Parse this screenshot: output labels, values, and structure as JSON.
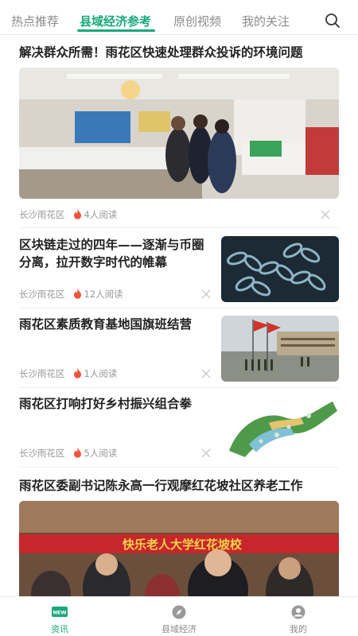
{
  "top_tabs": [
    {
      "label": "热点推荐",
      "active": false
    },
    {
      "label": "县域经济参考",
      "active": true
    },
    {
      "label": "原创视频",
      "active": false
    },
    {
      "label": "我的关注",
      "active": false
    }
  ],
  "articles": [
    {
      "title": "解决群众所需！雨花区快速处理群众投诉的环境问题",
      "source": "长沙雨花区",
      "reads": "4人阅读",
      "image": "kitchen-photo"
    },
    {
      "title": "区块链走过的四年——逐渐与币圈分离，拉开数字时代的帷幕",
      "source": "长沙雨花区",
      "reads": "12人阅读",
      "image": "blockchain-chain-photo"
    },
    {
      "title": "雨花区素质教育基地国旗班结营",
      "source": "长沙雨花区",
      "reads": "1人阅读",
      "image": "flag-ceremony-photo"
    },
    {
      "title": "雨花区打响打好乡村振兴组合拳",
      "source": "长沙雨花区",
      "reads": "5人阅读",
      "image": "rural-aerial-photo"
    },
    {
      "title": "雨花区委副书记陈永高一行观摩红花坡社区养老工作",
      "banner_text": "快乐老人大学红花坡校",
      "image": "community-visit-photo"
    }
  ],
  "bottom_nav": [
    {
      "label": "资讯",
      "badge": "NEW",
      "icon": "news-icon",
      "active": true
    },
    {
      "label": "县域经济",
      "icon": "compass-icon",
      "active": false
    },
    {
      "label": "我的",
      "icon": "user-icon",
      "active": false
    }
  ],
  "colors": {
    "accent": "#19a97b",
    "fire": "#f2543a",
    "muted": "#999999"
  }
}
